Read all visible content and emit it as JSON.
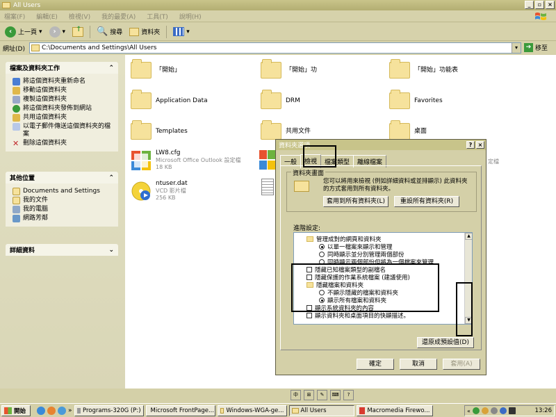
{
  "window": {
    "title": "All Users"
  },
  "menu": [
    "檔案(F)",
    "編輯(E)",
    "檢視(V)",
    "我的最愛(A)",
    "工具(T)",
    "說明(H)"
  ],
  "toolbar": {
    "back": "上一頁",
    "search": "搜尋",
    "folders": "資料夾"
  },
  "address": {
    "label": "網址(D)",
    "value": "C:\\Documents and Settings\\All Users",
    "go": "移至"
  },
  "sidebar": {
    "tasks_title": "檔案及資料夾工作",
    "tasks": [
      "將這個資料夾重新命名",
      "移動這個資料夾",
      "複製這個資料夾",
      "將這個資料夾發佈到網站",
      "共用這個資料夾",
      "以電子郵件傳送這個資料夾的檔案",
      "刪除這個資料夾"
    ],
    "places_title": "其他位置",
    "places": [
      "Documents and Settings",
      "我的文件",
      "我的電腦",
      "網路芳鄰"
    ],
    "details_title": "詳細資料"
  },
  "files": [
    {
      "name": "「開始」"
    },
    {
      "name": "「開始」功"
    },
    {
      "name": "「開始」功能表"
    },
    {
      "name": "Application Data"
    },
    {
      "name": "DRM"
    },
    {
      "name": "Favorites"
    },
    {
      "name": "Templates"
    },
    {
      "name": "共用文件"
    },
    {
      "name": "桌面"
    },
    {
      "name": "LW8.cfg",
      "type": "Microsoft Office Outlook 設定檔",
      "size": "18 KB"
    },
    {
      "name": "ntuser.dat",
      "type": "VCD 影片檔",
      "size": "256 KB"
    }
  ],
  "dialog": {
    "title": "資料夾選項",
    "tabs": [
      "一般",
      "檢視",
      "檔案類型",
      "離線檔案"
    ],
    "group_title": "資料夾畫面",
    "group_desc": "您可以將用來檢視 (例如詳細資料或並排顯示) 此資料夾的方式套用到所有資料夾。",
    "apply_all": "套用到所有資料夾(L)",
    "reset_all": "重設所有資料夾(R)",
    "advanced": "進階設定:",
    "tree": [
      {
        "kind": "folder",
        "text": "管理成對的網頁和資料夾"
      },
      {
        "kind": "radio-on",
        "text": "以單一檔案來顯示和管理"
      },
      {
        "kind": "radio",
        "text": "同時顯示並分別管理兩個部份"
      },
      {
        "kind": "radio",
        "text": "同時顯示兩個部份但將為一個檔案來管理"
      },
      {
        "kind": "check",
        "text": "隱藏已知檔案類型的副檔名"
      },
      {
        "kind": "check",
        "text": "隱藏保護的作業系統檔案 (建議使用)"
      },
      {
        "kind": "folder",
        "text": "隱藏檔案和資料夾"
      },
      {
        "kind": "radio",
        "text": "不顯示隱藏的檔案和資料夾"
      },
      {
        "kind": "radio-on",
        "text": "顯示所有檔案和資料夾"
      },
      {
        "kind": "check",
        "text": "顯示系統資料夾的內容"
      },
      {
        "kind": "check",
        "text": "顯示資料夾和桌面項目的快顯描述。"
      }
    ],
    "restore": "還原成預設值(D)",
    "ok": "確定",
    "cancel": "取消",
    "apply": "套用(A)",
    "partial_right": "定檔"
  },
  "taskbar": {
    "start": "開始",
    "items": [
      "Programs-320G (P:)",
      "Microsoft FrontPage...",
      "Windows-WGA-ge...",
      "All Users",
      "Macromedia Firewo..."
    ],
    "clock": "13:26"
  }
}
